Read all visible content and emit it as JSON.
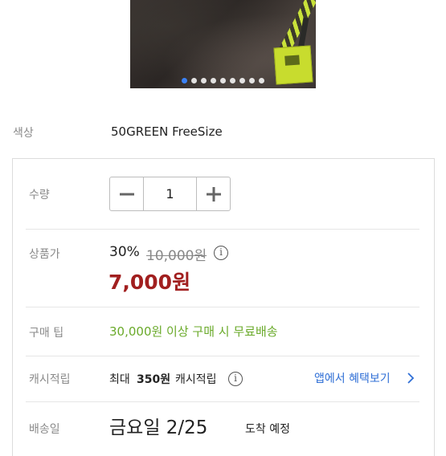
{
  "gallery": {
    "dot_count": 9,
    "active_index": 0
  },
  "color": {
    "label": "색상",
    "value": "50GREEN FreeSize"
  },
  "quantity": {
    "label": "수량",
    "value": "1",
    "minus_icon": "minus-icon",
    "plus_icon": "plus-icon"
  },
  "price": {
    "label": "상품가",
    "discount": "30%",
    "original": "10,000원",
    "final": "7,000원",
    "accent": "#a11f1f"
  },
  "tip": {
    "label": "구매 팁",
    "text": "30,000원 이상 구매 시 무료배송",
    "color": "#6aaa2a"
  },
  "cash": {
    "label": "캐시적립",
    "prefix": "최대",
    "amount": "350원",
    "suffix": "캐시적립",
    "link": "앱에서 혜택보기",
    "link_color": "#2f6fd6"
  },
  "delivery": {
    "label": "배송일",
    "date": "금요일 2/25",
    "suffix": "도착 예정"
  }
}
